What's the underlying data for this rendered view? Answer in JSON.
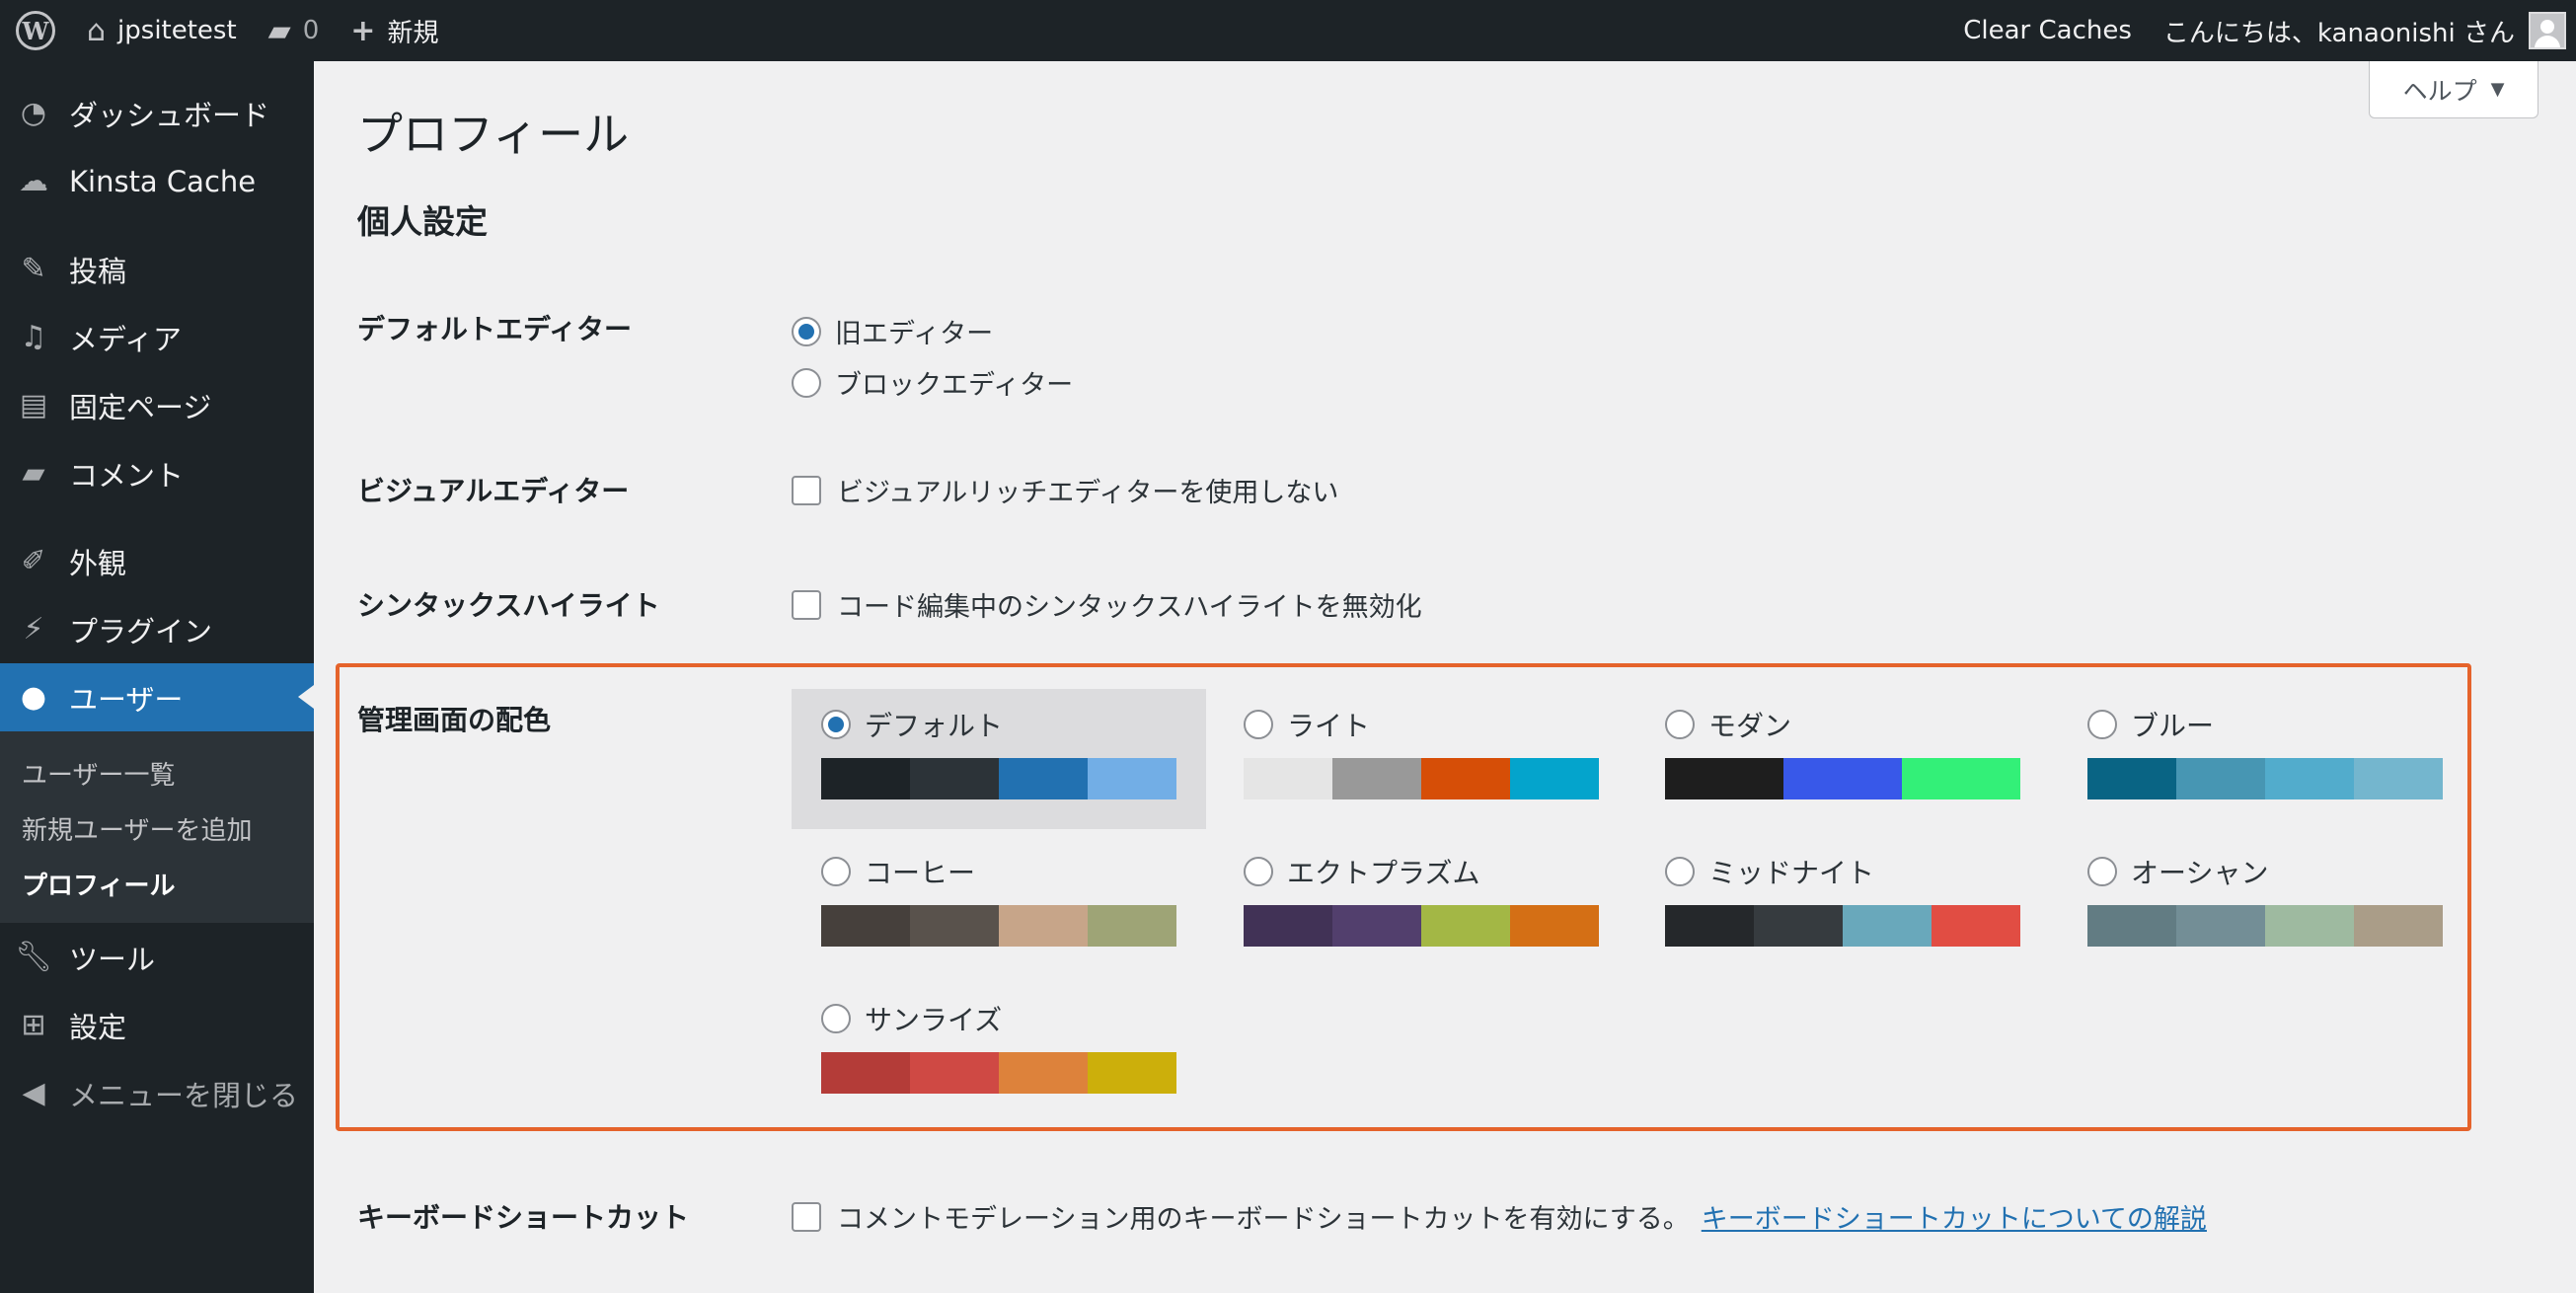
{
  "adminbar": {
    "site_name": "jpsitetest",
    "comments_count": "0",
    "new_label": "新規",
    "clear_caches": "Clear Caches",
    "greeting": "こんにちは、kanaonishi さん"
  },
  "sidebar": {
    "items": [
      {
        "label": "ダッシュボード",
        "icon": "dashboard-icon"
      },
      {
        "label": "Kinsta Cache",
        "icon": "cloud-icon"
      },
      {
        "label": "投稿",
        "icon": "pin-icon"
      },
      {
        "label": "メディア",
        "icon": "media-icon"
      },
      {
        "label": "固定ページ",
        "icon": "page-icon"
      },
      {
        "label": "コメント",
        "icon": "comment-icon"
      },
      {
        "label": "外観",
        "icon": "brush-icon"
      },
      {
        "label": "プラグイン",
        "icon": "plugin-icon"
      },
      {
        "label": "ユーザー",
        "icon": "user-icon"
      },
      {
        "label": "ツール",
        "icon": "wrench-icon"
      },
      {
        "label": "設定",
        "icon": "settings-icon"
      },
      {
        "label": "メニューを閉じる",
        "icon": "collapse-icon"
      }
    ],
    "submenu": [
      "ユーザー一覧",
      "新規ユーザーを追加",
      "プロフィール"
    ]
  },
  "main": {
    "help": "ヘルプ",
    "page_title": "プロフィール",
    "section_title": "個人設定",
    "default_editor": {
      "label": "デフォルトエディター",
      "options": [
        "旧エディター",
        "ブロックエディター"
      ],
      "selected": "旧エディター"
    },
    "visual_editor": {
      "label": "ビジュアルエディター",
      "checkbox": "ビジュアルリッチエディターを使用しない",
      "checked": false
    },
    "syntax": {
      "label": "シンタックスハイライト",
      "checkbox": "コード編集中のシンタックスハイライトを無効化",
      "checked": false
    },
    "color_scheme": {
      "label": "管理画面の配色",
      "selected": "デフォルト",
      "schemes": [
        {
          "name": "デフォルト",
          "colors": [
            "#1d2327",
            "#2c3338",
            "#2271b1",
            "#72aee6"
          ]
        },
        {
          "name": "ライト",
          "colors": [
            "#e5e5e5",
            "#999999",
            "#d64e07",
            "#04a4cc"
          ]
        },
        {
          "name": "モダン",
          "colors": [
            "#1e1e1e",
            "#3858e9",
            "#33f078"
          ]
        },
        {
          "name": "ブルー",
          "colors": [
            "#096484",
            "#4796b3",
            "#52accc",
            "#74b6ce"
          ]
        },
        {
          "name": "コーヒー",
          "colors": [
            "#46403c",
            "#59524c",
            "#c7a589",
            "#9ea476"
          ]
        },
        {
          "name": "エクトプラズム",
          "colors": [
            "#413256",
            "#523f6d",
            "#a3b745",
            "#d46f15"
          ]
        },
        {
          "name": "ミッドナイト",
          "colors": [
            "#25282b",
            "#363b3f",
            "#69a8bb",
            "#e14d43"
          ]
        },
        {
          "name": "オーシャン",
          "colors": [
            "#627c83",
            "#738e96",
            "#9ebaa0",
            "#aa9d88"
          ]
        },
        {
          "name": "サンライズ",
          "colors": [
            "#b43c38",
            "#cf4944",
            "#dd823b",
            "#ccaf0b"
          ]
        }
      ]
    },
    "keyboard": {
      "label": "キーボードショートカット",
      "checkbox": "コメントモデレーション用のキーボードショートカットを有効にする。",
      "link": "キーボードショートカットについての解説",
      "checked": false
    }
  }
}
